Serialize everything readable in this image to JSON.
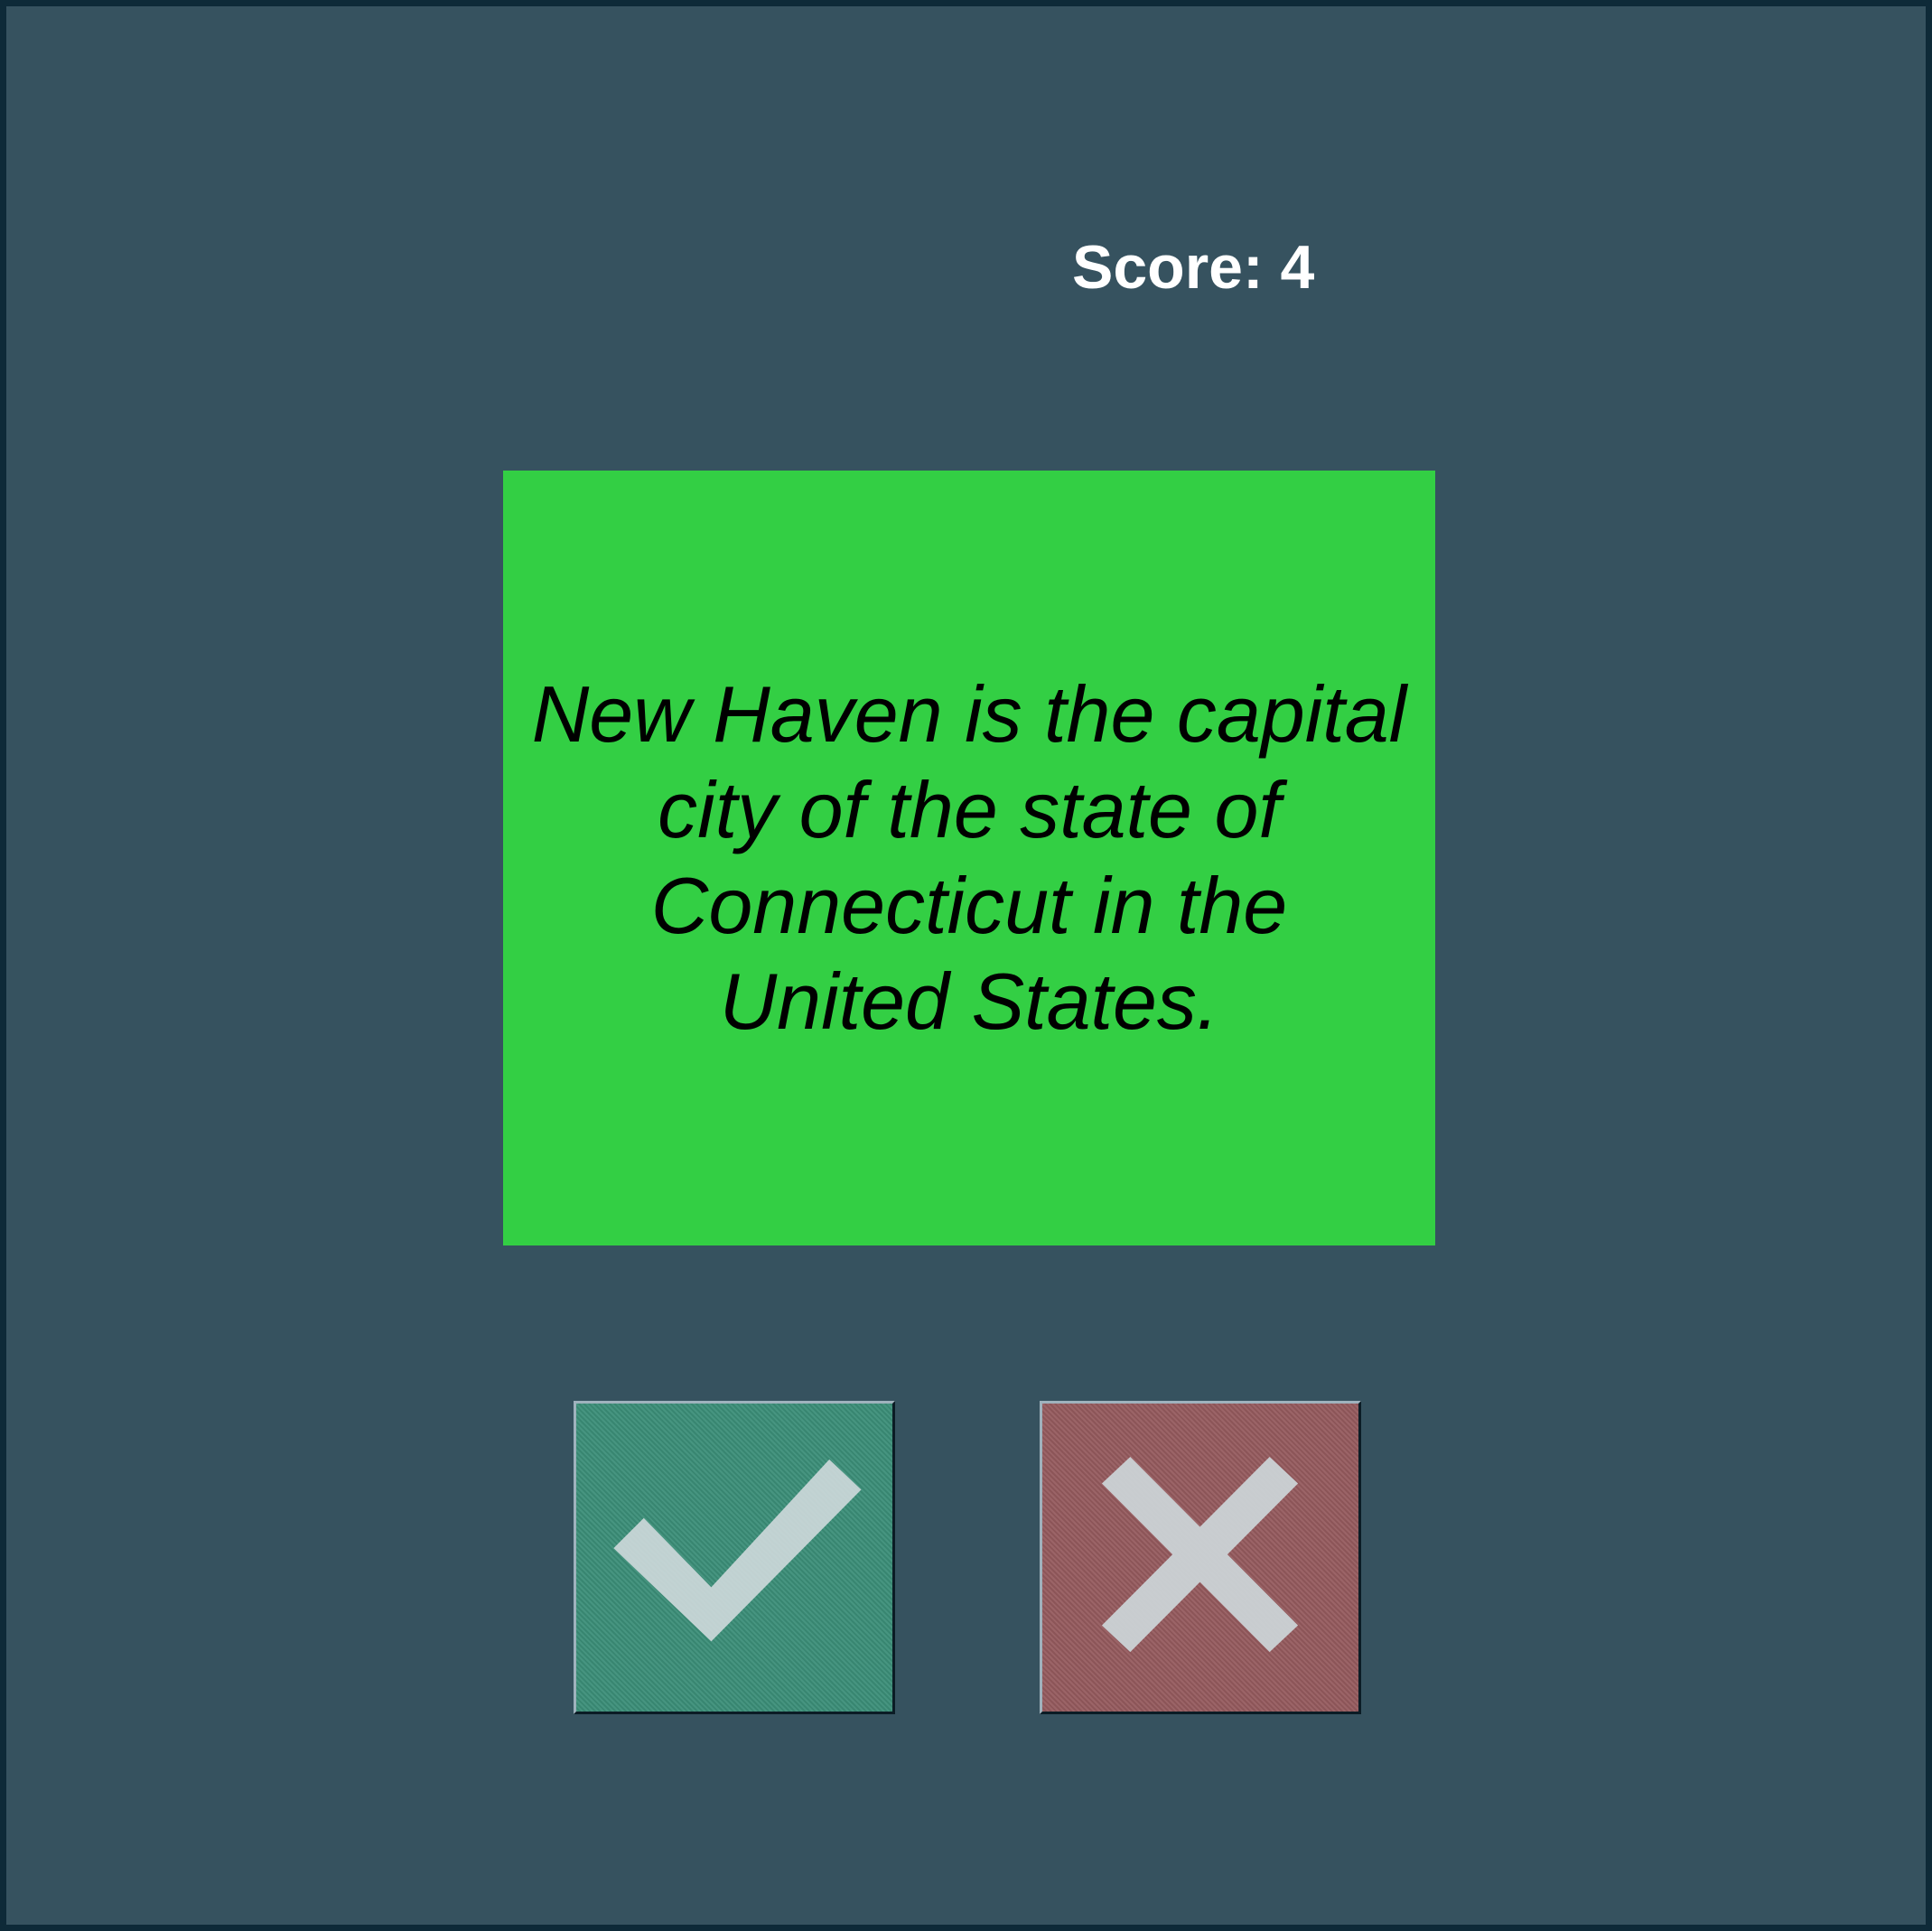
{
  "score": {
    "text": "Score: 4"
  },
  "statement": {
    "text": "New Haven is the capital city of the state of Connecticut in the United States."
  },
  "colors": {
    "background": "#36525f",
    "frame": "#0e2a38",
    "card": "#33cf44",
    "true_button": "#3b8e78",
    "false_button": "#955a5e",
    "icon": "#cfd9dc"
  },
  "buttons": {
    "true_icon": "check-icon",
    "false_icon": "x-icon"
  }
}
